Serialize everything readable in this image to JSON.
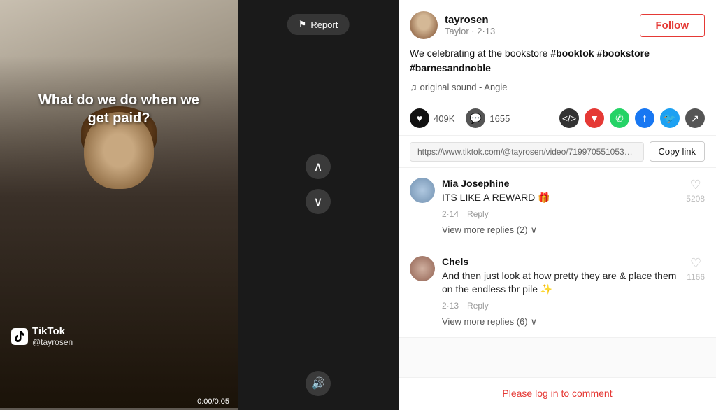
{
  "video": {
    "overlay_text": "What do we do when we\nget paid?",
    "brand": "TikTok",
    "username": "@tayrosen",
    "time": "0:00/0:05",
    "progress_pct": 0
  },
  "controls": {
    "report_label": "Report",
    "nav_up": "∧",
    "nav_down": "∨",
    "volume": "🔊"
  },
  "post": {
    "username": "tayrosen",
    "subtitle": "Taylor · 2·13",
    "caption": "We celebrating at the bookstore #booktok #bookstore #barnesandnoble",
    "sound": "original sound - Angie",
    "likes": "409K",
    "comments": "1655",
    "follow_label": "Follow",
    "url": "https://www.tiktok.com/@tayrosen/video/71997055105375...",
    "copy_link_label": "Copy link"
  },
  "comments": [
    {
      "username": "Mia Josephine",
      "text": "ITS LIKE A REWARD 🎁",
      "date": "2·14",
      "reply_label": "Reply",
      "view_replies": "View more replies (2)",
      "likes": "5208"
    },
    {
      "username": "Chels",
      "text": "And then just look at how pretty they are & place them on the endless tbr pile ✨",
      "date": "2·13",
      "reply_label": "Reply",
      "view_replies": "View more replies (6)",
      "likes": "1166"
    }
  ],
  "footer": {
    "login_prompt": "Please log in to comment"
  }
}
